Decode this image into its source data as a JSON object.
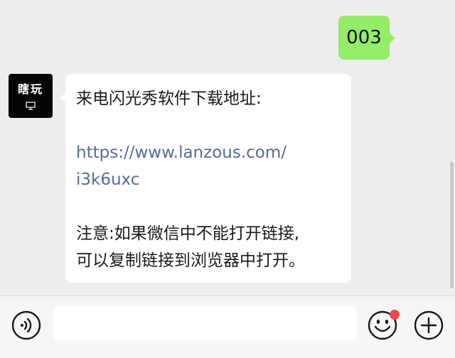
{
  "chat": {
    "sent_message": "003",
    "avatar_text": "瞎玩",
    "received_message": {
      "line1": "来电闪光秀软件下载地址:",
      "link_line1": "https://www.lanzous.com/",
      "link_line2": "i3k6uxc",
      "note_line1": "注意:如果微信中不能打开链接,",
      "note_line2": "可以复制链接到浏览器中打开。"
    }
  },
  "input_bar": {
    "voice_icon": "voice-icon",
    "emoji_icon": "emoji-icon",
    "plus_icon": "plus-icon",
    "notification_dot": true
  },
  "colors": {
    "chat_background": "#ededed",
    "sent_bubble": "#95ec69",
    "received_bubble": "#ffffff",
    "link": "#576b95",
    "notification_dot": "#f04848"
  }
}
